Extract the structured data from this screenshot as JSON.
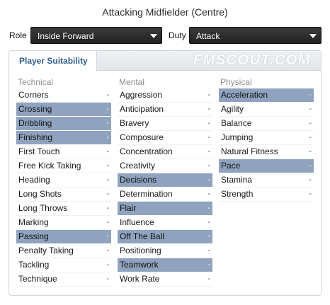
{
  "title": "Attacking Midfielder (Centre)",
  "role": {
    "label": "Role",
    "value": "Inside Forward"
  },
  "duty": {
    "label": "Duty",
    "value": "Attack"
  },
  "tab": {
    "label": "Player Suitability"
  },
  "watermark": "FMSCOUT.COM",
  "highlight_color": "#8fa3bf",
  "columns": [
    {
      "title": "Technical",
      "items": [
        {
          "name": "Corners",
          "value": "-",
          "highlighted": false
        },
        {
          "name": "Crossing",
          "value": "-",
          "highlighted": true
        },
        {
          "name": "Dribbling",
          "value": "-",
          "highlighted": true
        },
        {
          "name": "Finishing",
          "value": "-",
          "highlighted": true
        },
        {
          "name": "First Touch",
          "value": "-",
          "highlighted": false
        },
        {
          "name": "Free Kick Taking",
          "value": "-",
          "highlighted": false
        },
        {
          "name": "Heading",
          "value": "-",
          "highlighted": false
        },
        {
          "name": "Long Shots",
          "value": "-",
          "highlighted": false
        },
        {
          "name": "Long Throws",
          "value": "-",
          "highlighted": false
        },
        {
          "name": "Marking",
          "value": "-",
          "highlighted": false
        },
        {
          "name": "Passing",
          "value": "-",
          "highlighted": true
        },
        {
          "name": "Penalty Taking",
          "value": "-",
          "highlighted": false
        },
        {
          "name": "Tackling",
          "value": "-",
          "highlighted": false
        },
        {
          "name": "Technique",
          "value": "-",
          "highlighted": false
        }
      ]
    },
    {
      "title": "Mental",
      "items": [
        {
          "name": "Aggression",
          "value": "-",
          "highlighted": false
        },
        {
          "name": "Anticipation",
          "value": "-",
          "highlighted": false
        },
        {
          "name": "Bravery",
          "value": "-",
          "highlighted": false
        },
        {
          "name": "Composure",
          "value": "-",
          "highlighted": false
        },
        {
          "name": "Concentration",
          "value": "-",
          "highlighted": false
        },
        {
          "name": "Creativity",
          "value": "-",
          "highlighted": false
        },
        {
          "name": "Decisions",
          "value": "-",
          "highlighted": true
        },
        {
          "name": "Determination",
          "value": "-",
          "highlighted": false
        },
        {
          "name": "Flair",
          "value": "-",
          "highlighted": true
        },
        {
          "name": "Influence",
          "value": "-",
          "highlighted": false
        },
        {
          "name": "Off The Ball",
          "value": "-",
          "highlighted": true
        },
        {
          "name": "Positioning",
          "value": "-",
          "highlighted": false
        },
        {
          "name": "Teamwork",
          "value": "-",
          "highlighted": true
        },
        {
          "name": "Work Rate",
          "value": "-",
          "highlighted": false
        }
      ]
    },
    {
      "title": "Physical",
      "items": [
        {
          "name": "Acceleration",
          "value": "-",
          "highlighted": true
        },
        {
          "name": "Agility",
          "value": "-",
          "highlighted": false
        },
        {
          "name": "Balance",
          "value": "-",
          "highlighted": false
        },
        {
          "name": "Jumping",
          "value": "-",
          "highlighted": false
        },
        {
          "name": "Natural Fitness",
          "value": "-",
          "highlighted": false
        },
        {
          "name": "Pace",
          "value": "-",
          "highlighted": true
        },
        {
          "name": "Stamina",
          "value": "-",
          "highlighted": false
        },
        {
          "name": "Strength",
          "value": "-",
          "highlighted": false
        }
      ]
    }
  ]
}
